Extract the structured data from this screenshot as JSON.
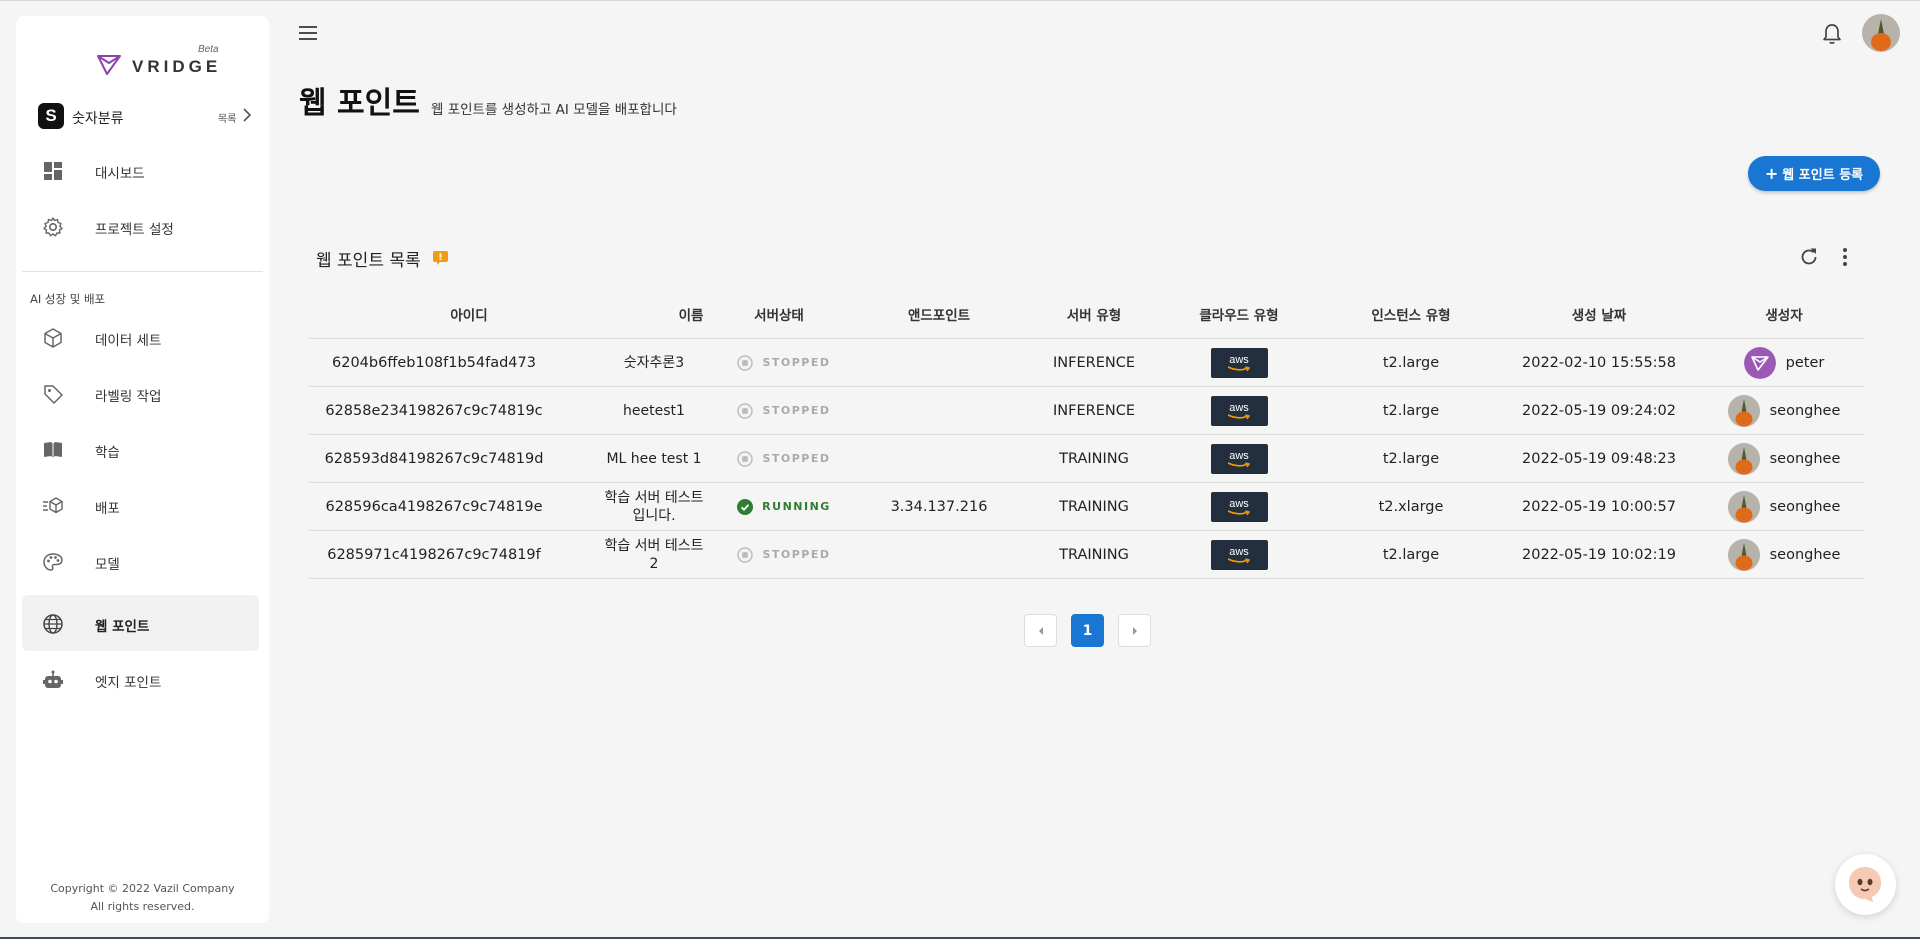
{
  "app": {
    "logo_text": "VRIDGE",
    "logo_badge": "Beta",
    "project_badge": "S",
    "project_name": "숫자분류",
    "project_list_label": "목록",
    "copyright_line1": "Copyright © 2022 Vazil Company",
    "copyright_line2": "All rights reserved."
  },
  "sidebar": {
    "top_items": [
      {
        "label": "대시보드",
        "icon": "dashboard-icon"
      },
      {
        "label": "프로젝트 설정",
        "icon": "gear-icon"
      }
    ],
    "section_label": "AI 성장 및 배포",
    "items": [
      {
        "label": "데이터 세트",
        "icon": "cube-icon"
      },
      {
        "label": "라벨링 작업",
        "icon": "tag-icon"
      },
      {
        "label": "학습",
        "icon": "book-icon"
      },
      {
        "label": "배포",
        "icon": "deploy-icon"
      },
      {
        "label": "모델",
        "icon": "palette-icon"
      },
      {
        "label": "웹 포인트",
        "icon": "globe-icon",
        "active": true
      },
      {
        "label": "엣지 포인트",
        "icon": "robot-icon"
      }
    ]
  },
  "header": {
    "title": "웹 포인트",
    "subtitle": "웹 포인트를 생성하고 AI 모델을 배포합니다",
    "add_button": "웹 포인트 등록"
  },
  "list": {
    "title": "웹 포인트 목록",
    "columns": [
      "아이디",
      "이름",
      "서버상태",
      "앤드포인트",
      "서버 유형",
      "클라우드 유형",
      "인스턴스 유형",
      "생성 날짜",
      "생성자"
    ],
    "rows": [
      {
        "id": "6204b6ffeb108f1b54fad473",
        "name": "숫자추론3",
        "status": "STOPPED",
        "endpoint": "",
        "server_type": "INFERENCE",
        "cloud": "aws",
        "instance": "t2.large",
        "created": "2022-02-10 15:55:58",
        "creator": "peter"
      },
      {
        "id": "62858e234198267c9c74819c",
        "name": "heetest1",
        "status": "STOPPED",
        "endpoint": "",
        "server_type": "INFERENCE",
        "cloud": "aws",
        "instance": "t2.large",
        "created": "2022-05-19 09:24:02",
        "creator": "seonghee"
      },
      {
        "id": "628593d84198267c9c74819d",
        "name": "ML hee test 1",
        "status": "STOPPED",
        "endpoint": "",
        "server_type": "TRAINING",
        "cloud": "aws",
        "instance": "t2.large",
        "created": "2022-05-19 09:48:23",
        "creator": "seonghee"
      },
      {
        "id": "628596ca4198267c9c74819e",
        "name": "학습 서버 테스트 입니다.",
        "status": "RUNNING",
        "endpoint": "3.34.137.216",
        "server_type": "TRAINING",
        "cloud": "aws",
        "instance": "t2.xlarge",
        "created": "2022-05-19 10:00:57",
        "creator": "seonghee"
      },
      {
        "id": "6285971c4198267c9c74819f",
        "name": "학습 서버 테스트 2",
        "status": "STOPPED",
        "endpoint": "",
        "server_type": "TRAINING",
        "cloud": "aws",
        "instance": "t2.large",
        "created": "2022-05-19 10:02:19",
        "creator": "seonghee"
      }
    ]
  },
  "pagination": {
    "current": "1"
  },
  "colors": {
    "accent": "#1976d2",
    "running": "#2e7d32",
    "stopped": "#aaaaaa",
    "aws_bg": "#232f3e",
    "brand": "#8e44ad"
  }
}
